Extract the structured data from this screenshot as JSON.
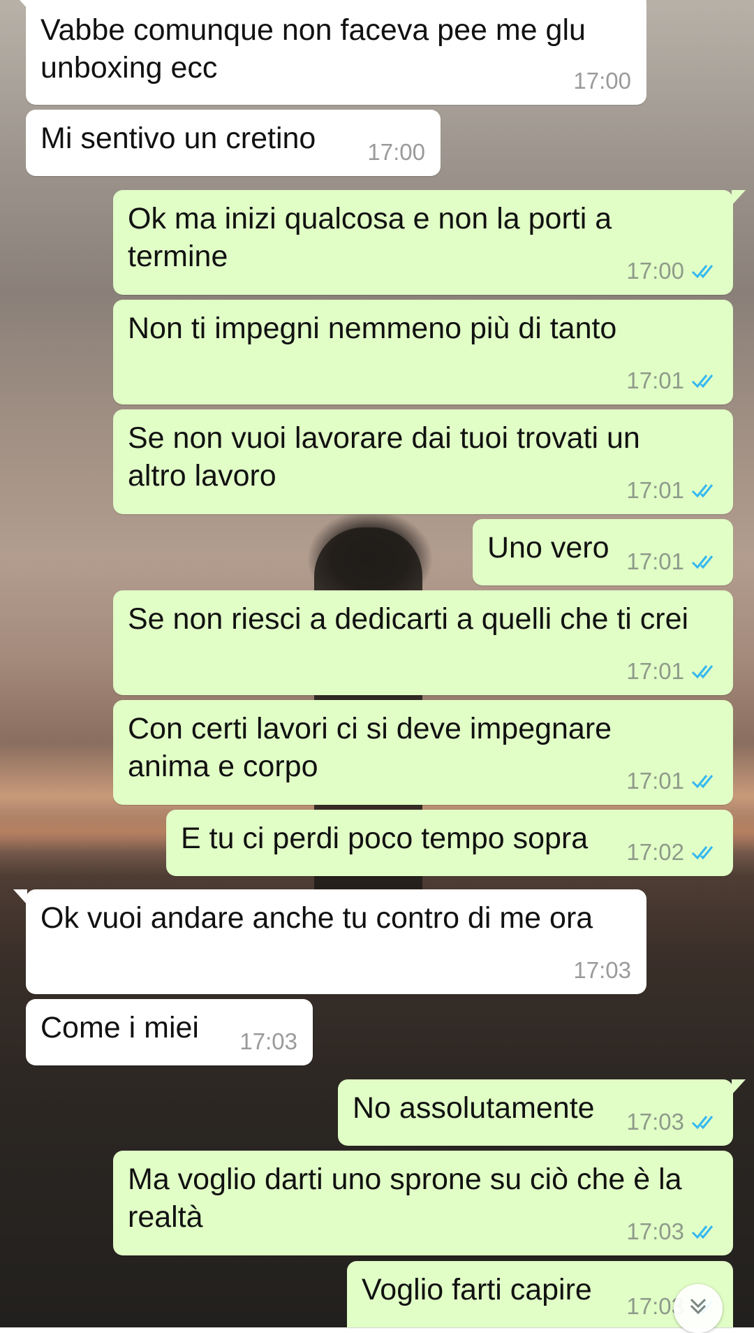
{
  "messages": [
    {
      "direction": "in",
      "text_line1": "Vabbe comunque non faceva pee me glu",
      "text_line2": "unboxing ecc",
      "time": "17:00"
    },
    {
      "direction": "in",
      "text_line1": "Mi sentivo un cretino",
      "time": "17:00"
    },
    {
      "direction": "out",
      "text_line1": "Ok ma inizi qualcosa e non la porti a",
      "text_line2": "termine",
      "time": "17:00",
      "status": "read"
    },
    {
      "direction": "out",
      "text_line1": "Non ti impegni nemmeno più di tanto",
      "time": "17:01",
      "status": "read"
    },
    {
      "direction": "out",
      "text_line1": "Se non vuoi lavorare dai tuoi trovati un",
      "text_line2": "altro lavoro",
      "time": "17:01",
      "status": "read"
    },
    {
      "direction": "out",
      "text_line1": "Uno vero",
      "time": "17:01",
      "status": "read"
    },
    {
      "direction": "out",
      "text_line1": "Se non riesci a dedicarti a quelli che ti crei",
      "time": "17:01",
      "status": "read"
    },
    {
      "direction": "out",
      "text_line1": "Con certi lavori ci si deve impegnare",
      "text_line2": "anima e corpo",
      "time": "17:01",
      "status": "read"
    },
    {
      "direction": "out",
      "text_line1": "E tu ci perdi poco tempo sopra",
      "time": "17:02",
      "status": "read"
    },
    {
      "direction": "in",
      "text_line1": "Ok vuoi andare anche tu contro di me ora",
      "time": "17:03"
    },
    {
      "direction": "in",
      "text_line1": "Come i miei",
      "time": "17:03"
    },
    {
      "direction": "out",
      "text_line1": "No assolutamente",
      "time": "17:03",
      "status": "read"
    },
    {
      "direction": "out",
      "text_line1": "Ma voglio darti uno sprone su ciò che è la",
      "text_line2": "realtà",
      "time": "17:03",
      "status": "read"
    },
    {
      "direction": "out",
      "text_line1": "Voglio farti capire",
      "time": "17:03",
      "status": "read"
    }
  ],
  "icons": {
    "read_receipt": "double-check-icon",
    "scroll_down": "chevron-double-down-icon"
  },
  "colors": {
    "incoming_bubble": "#ffffff",
    "outgoing_bubble": "#e1fec6",
    "read_tick": "#34b7f1",
    "timestamp": "#8e9a8a"
  }
}
